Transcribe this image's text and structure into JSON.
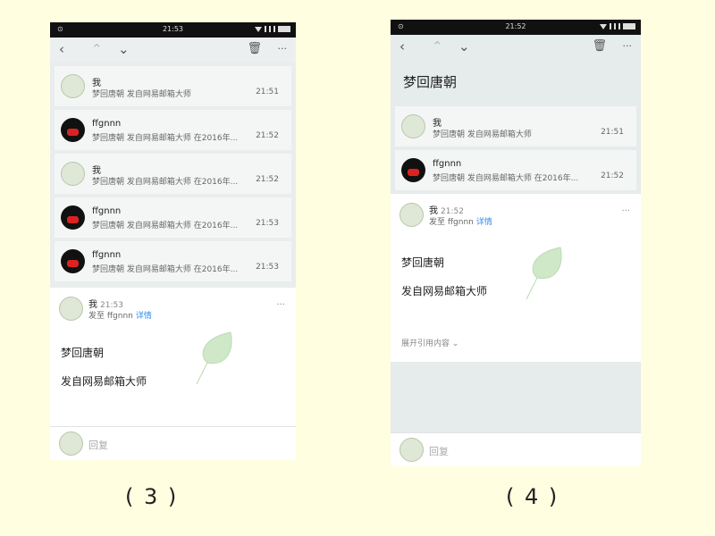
{
  "screen3": {
    "status_time": "21:53",
    "status_left": "⊙",
    "icons": {
      "back": "chevron-left-icon",
      "up": "chevron-up-icon",
      "down": "chevron-down-icon",
      "trash": "trash-icon",
      "more": "more-icon"
    },
    "messages": [
      {
        "sender": "我",
        "snippet": "梦回唐朝 发自网易邮箱大师",
        "time": "21:51",
        "avatar": "leaf"
      },
      {
        "sender": "ffgnnn",
        "snippet": "梦回唐朝 发自网易邮箱大师 在2016年...",
        "time": "21:52",
        "avatar": "bear"
      },
      {
        "sender": "我",
        "snippet": "梦回唐朝 发自网易邮箱大师 在2016年...",
        "time": "21:52",
        "avatar": "leaf"
      },
      {
        "sender": "ffgnnn",
        "snippet": "梦回唐朝 发自网易邮箱大师 在2016年...",
        "time": "21:53",
        "avatar": "bear"
      },
      {
        "sender": "ffgnnn",
        "snippet": "梦回唐朝 发自网易邮箱大师 在2016年...",
        "time": "21:53",
        "avatar": "bear"
      }
    ],
    "detail": {
      "from": "我",
      "time": "21:53",
      "to": "发至 ffgnnn",
      "details_link": "详情",
      "more": "···",
      "body_line1": "梦回唐朝",
      "body_line2": "发自网易邮箱大师"
    },
    "reply_label": "回复",
    "caption": "( 3 )"
  },
  "screen4": {
    "status_time": "21:52",
    "status_left": "⊙",
    "subject": "梦回唐朝",
    "messages": [
      {
        "sender": "我",
        "snippet": "梦回唐朝 发自网易邮箱大师",
        "time": "21:51",
        "avatar": "leaf"
      },
      {
        "sender": "ffgnnn",
        "snippet": "梦回唐朝 发自网易邮箱大师 在2016年...",
        "time": "21:52",
        "avatar": "bear"
      }
    ],
    "detail": {
      "from": "我",
      "time": "21:52",
      "to": "发至 ffgnnn",
      "details_link": "详情",
      "more": "···",
      "body_line1": "梦回唐朝",
      "body_line2": "发自网易邮箱大师",
      "expand": "展开引用内容 ⌄"
    },
    "reply_label": "回复",
    "caption": "( 4 )"
  },
  "colors": {
    "page_bg": "#fffee0",
    "link": "#2f8cf0",
    "leaf": "#cfe8c8"
  }
}
